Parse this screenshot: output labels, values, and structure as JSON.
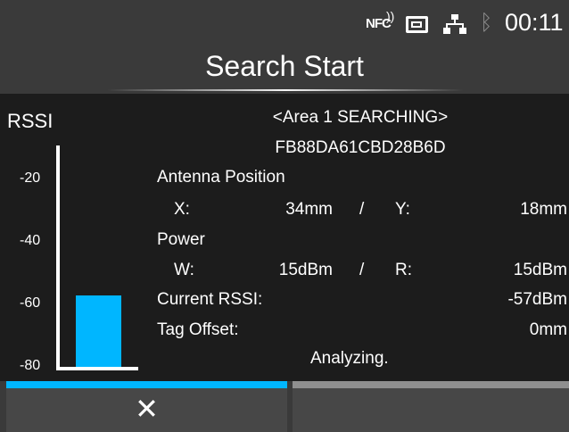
{
  "status_bar": {
    "nfc_label": "NFC",
    "clock": "00:11",
    "icons": [
      "nfc-icon",
      "sd-card-icon",
      "lan-icon",
      "bluetooth-icon"
    ]
  },
  "title": "Search Start",
  "rssi_panel": {
    "label": "RSSI",
    "ticks": [
      "-20",
      "-40",
      "-60",
      "-80"
    ],
    "current_rssi_dbm": -57,
    "scale_min": -80,
    "scale_max": -10,
    "bar_color": "#00b6ff"
  },
  "search": {
    "area_status": "<Area 1 SEARCHING>",
    "tag_id": "FB88DA61CBD28B6D",
    "antenna_position_label": "Antenna Position",
    "x_label": "X:",
    "x_value": "34mm",
    "sep1": "/",
    "y_label": "Y:",
    "y_value": "18mm",
    "power_label": "Power",
    "w_label": "W:",
    "w_value": "15dBm",
    "sep2": "/",
    "r_label": "R:",
    "r_value": "15dBm",
    "current_rssi_label": "Current RSSI:",
    "current_rssi_value": "-57dBm",
    "tag_offset_label": "Tag Offset:",
    "tag_offset_value": "0mm",
    "analyzing": "Analyzing."
  },
  "buttons": {
    "cancel_label": "✕",
    "cancel_icon": "close-icon"
  },
  "colors": {
    "accent": "#00b6ff",
    "background": "#3a3a3a",
    "content_bg": "#1c1c1c"
  }
}
